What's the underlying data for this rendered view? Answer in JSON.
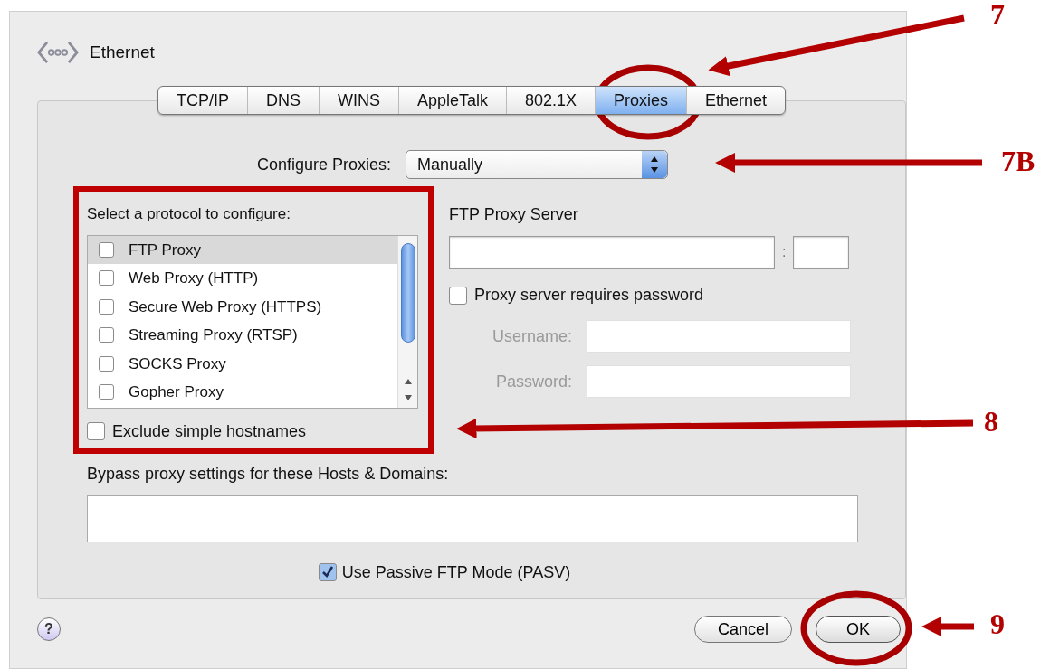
{
  "window": {
    "title": "Ethernet"
  },
  "tabs": [
    {
      "label": "TCP/IP",
      "selected": false
    },
    {
      "label": "DNS",
      "selected": false
    },
    {
      "label": "WINS",
      "selected": false
    },
    {
      "label": "AppleTalk",
      "selected": false
    },
    {
      "label": "802.1X",
      "selected": false
    },
    {
      "label": "Proxies",
      "selected": true
    },
    {
      "label": "Ethernet",
      "selected": false
    }
  ],
  "configure_proxies": {
    "label": "Configure Proxies:",
    "value": "Manually"
  },
  "protocol_list": {
    "label": "Select a protocol to configure:",
    "items": [
      {
        "label": "FTP Proxy",
        "checked": false,
        "selected": true
      },
      {
        "label": "Web Proxy (HTTP)",
        "checked": false,
        "selected": false
      },
      {
        "label": "Secure Web Proxy (HTTPS)",
        "checked": false,
        "selected": false
      },
      {
        "label": "Streaming Proxy (RTSP)",
        "checked": false,
        "selected": false
      },
      {
        "label": "SOCKS Proxy",
        "checked": false,
        "selected": false
      },
      {
        "label": "Gopher Proxy",
        "checked": false,
        "selected": false
      }
    ]
  },
  "exclude_simple_hostnames": {
    "label": "Exclude simple hostnames",
    "checked": false
  },
  "proxy_server": {
    "label": "FTP Proxy Server",
    "separator": ":"
  },
  "requires_password": {
    "label": "Proxy server requires password",
    "checked": false
  },
  "username": {
    "label": "Username:",
    "disabled": true
  },
  "password": {
    "label": "Password:",
    "disabled": true
  },
  "bypass": {
    "label": "Bypass proxy settings for these Hosts & Domains:"
  },
  "passive_ftp": {
    "label": "Use Passive FTP Mode (PASV)",
    "checked": true
  },
  "buttons": [
    {
      "label": "?",
      "kind": "help"
    },
    {
      "label": "Cancel",
      "kind": "normal"
    },
    {
      "label": "OK",
      "kind": "default"
    }
  ],
  "annotations": [
    {
      "label": "7"
    },
    {
      "label": "7B"
    },
    {
      "label": "8"
    },
    {
      "label": "9"
    }
  ]
}
